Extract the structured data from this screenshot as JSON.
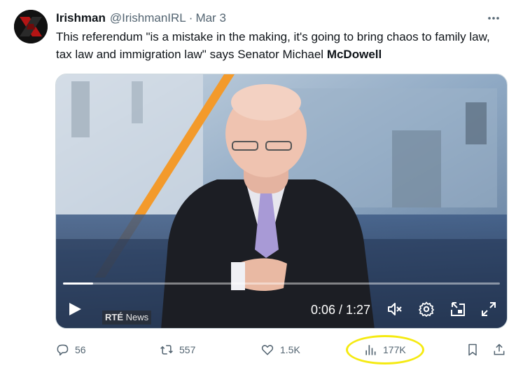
{
  "tweet": {
    "display_name": "Irishman",
    "handle": "@IrishmanIRL",
    "separator": "·",
    "date": "Mar 3",
    "text_before": "This referendum \"is a mistake in the making, it's going to bring chaos to family law, tax law and immigration law\" says Senator Michael ",
    "text_bold": "McDowell"
  },
  "video": {
    "current_time": "0:06",
    "duration": "1:27",
    "time_display": "0:06 / 1:27",
    "progress_fraction": 0.069,
    "broadcaster_logo_bold": "RTÉ",
    "broadcaster_logo_rest": "News"
  },
  "actions": {
    "replies": "56",
    "reposts": "557",
    "likes": "1.5K",
    "views": "177K"
  },
  "colors": {
    "text_primary": "#0f1419",
    "text_secondary": "#536471",
    "highlight": "#f5ea12",
    "border": "#cfd9de"
  },
  "icons": {
    "more": "more-dots-icon",
    "play": "play-icon",
    "mute": "volume-muted-icon",
    "settings": "gear-icon",
    "pip": "picture-in-picture-icon",
    "fullscreen": "fullscreen-icon",
    "reply": "reply-bubble-icon",
    "repost": "repost-icon",
    "like": "heart-icon",
    "views": "views-chart-icon",
    "bookmark": "bookmark-icon",
    "share": "share-icon"
  }
}
